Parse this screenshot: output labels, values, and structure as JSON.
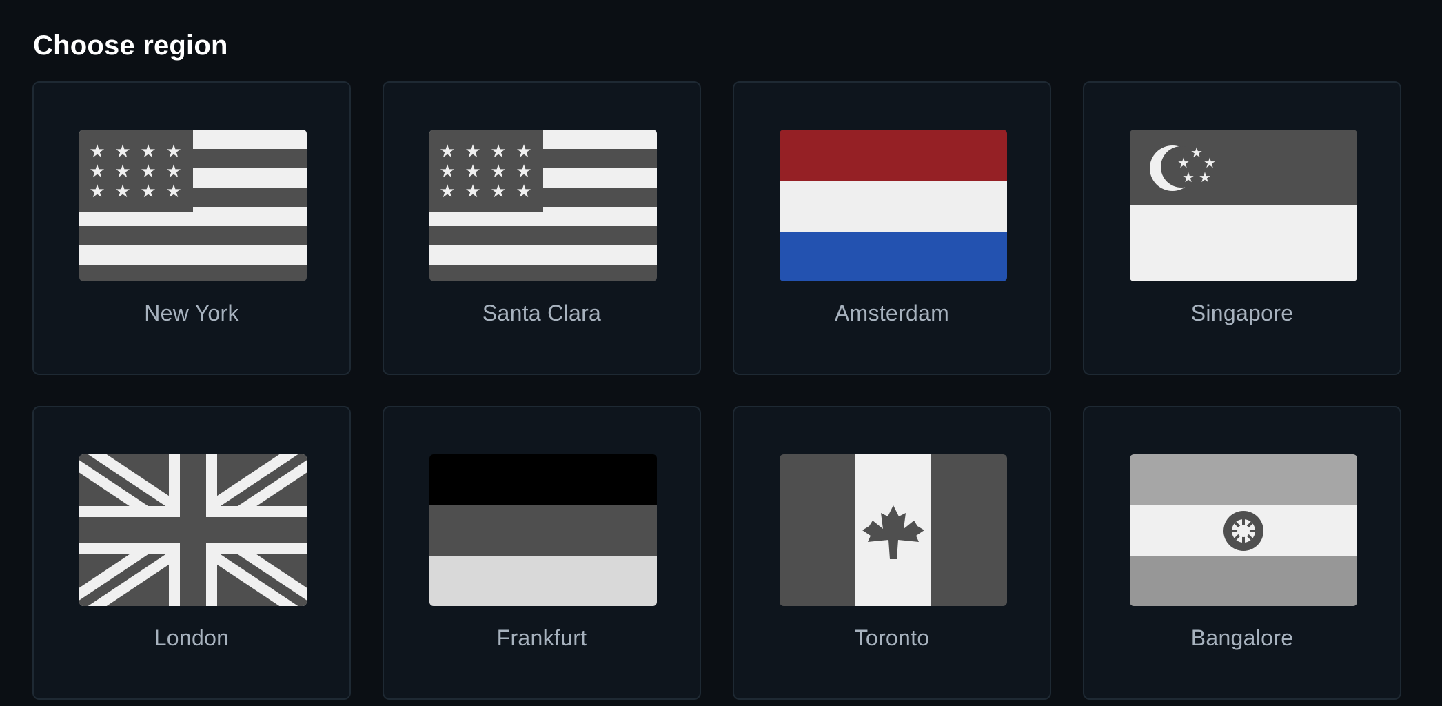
{
  "heading": "Choose region",
  "regions": [
    {
      "name": "New York",
      "flag_icon": "us-flag-icon"
    },
    {
      "name": "Santa Clara",
      "flag_icon": "us-flag-icon"
    },
    {
      "name": "Amsterdam",
      "flag_icon": "netherlands-flag-icon"
    },
    {
      "name": "Singapore",
      "flag_icon": "singapore-flag-icon"
    },
    {
      "name": "London",
      "flag_icon": "uk-flag-icon"
    },
    {
      "name": "Frankfurt",
      "flag_icon": "germany-flag-icon"
    },
    {
      "name": "Toronto",
      "flag_icon": "canada-flag-icon"
    },
    {
      "name": "Bangalore",
      "flag_icon": "india-flag-icon"
    }
  ],
  "colors": {
    "background": "#0b0f14",
    "card": "#0e151d",
    "card_border": "#1e2933",
    "label": "#a7b2be",
    "nl_red": "#952025",
    "nl_white": "#efefef",
    "nl_blue": "#2352b0"
  }
}
